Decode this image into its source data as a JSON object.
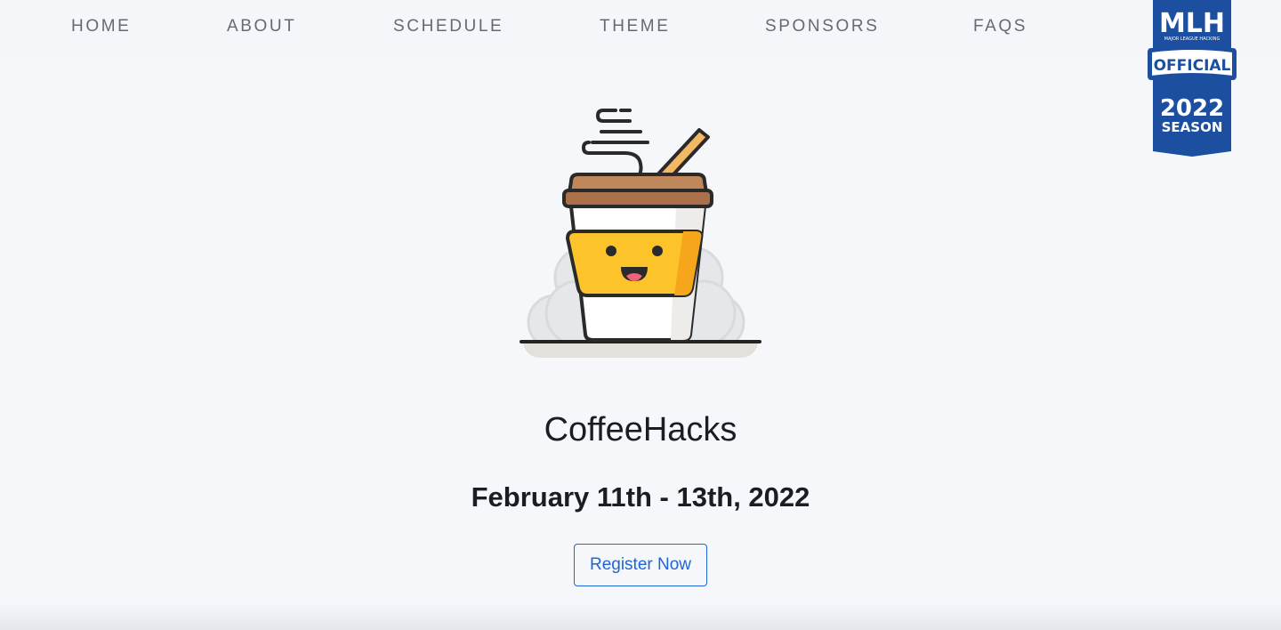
{
  "nav": {
    "items": [
      {
        "label": "HOME"
      },
      {
        "label": "ABOUT"
      },
      {
        "label": "SCHEDULE"
      },
      {
        "label": "THEME"
      },
      {
        "label": "SPONSORS"
      },
      {
        "label": "FAQS"
      }
    ]
  },
  "mlh_badge": {
    "logo": "MLH",
    "tagline": "MAJOR LEAGUE HACKING",
    "official": "OFFICIAL",
    "year": "2022",
    "season": "SEASON",
    "color": "#1c4fa0"
  },
  "hero": {
    "illustration": "coffee-cup-mascot",
    "title": "CoffeeHacks",
    "dates": "February 11th - 13th, 2022",
    "register_label": "Register Now"
  },
  "colors": {
    "background": "#f5f7fb",
    "accent": "#1d65d8",
    "cup_sleeve": "#fdc32a",
    "cup_lid": "#c0875a"
  }
}
